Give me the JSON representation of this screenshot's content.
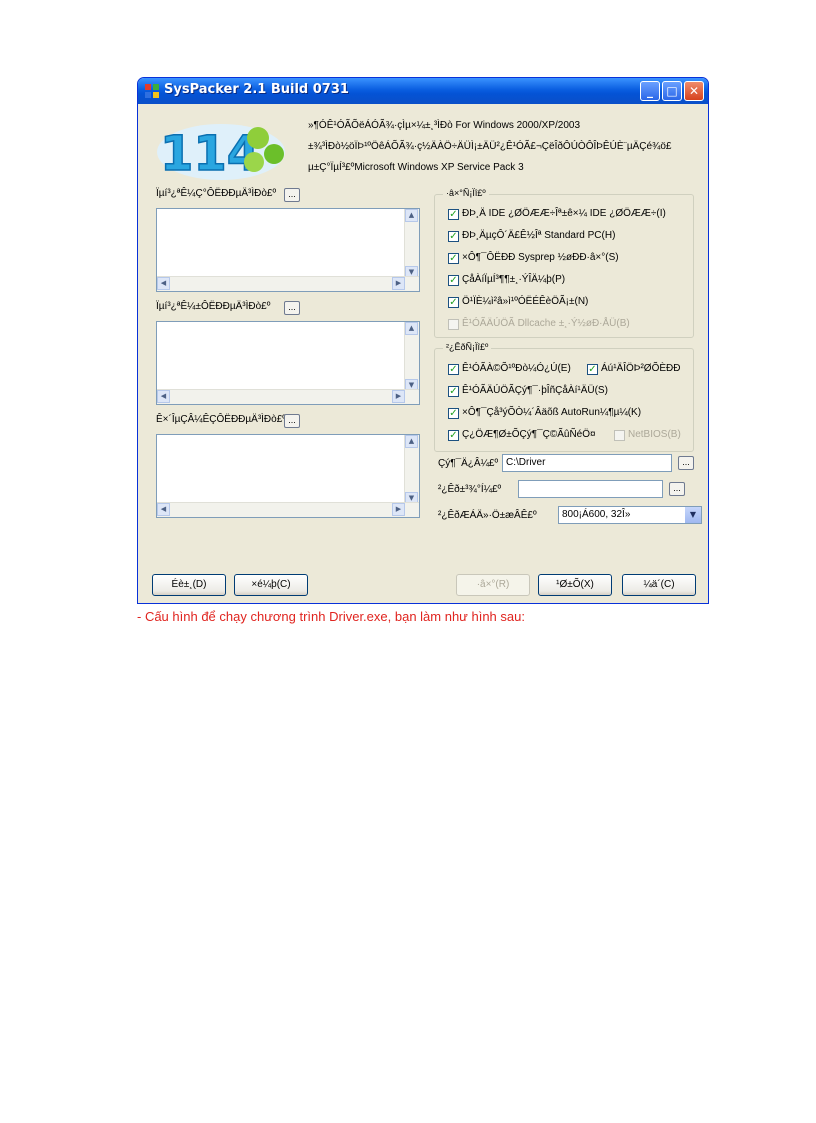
{
  "window": {
    "title": "SysPacker 2.1 Build 0731",
    "controls": {
      "minimize": "_",
      "maximize": "□",
      "close": "✕"
    }
  },
  "banner": {
    "logo_text": "114",
    "lines": [
      "»¶Ó­Ê¹ÓÃÕëÁÓÃ¾·çÌµ×¼±¸³ÌÐò For Windows 2000/XP/2003",
      "±¾³ÌÐò½öÏÞ¹ºÖêÁÕÃ¾·ç½ÄÀÖ÷ÄÜÌ¡±ÄÜ²¿Ê¹ÓÃ£¬ÇëÎðÔÚÒÔÎÞÊÚÈ¨µÄÇé¾ö£",
      "µ±Ç°ÏµÍ³£ºMicrosoft Windows XP Service Pack 3"
    ]
  },
  "left": {
    "groups": [
      {
        "label": "Ïµí³¿ªÊ¼Ç°ÔËÐÐµÄ³ÌÐò£º",
        "browse": "..."
      },
      {
        "label": "Ïµí³¿ªÊ¼±ÔËÐÐµÄ³ÌÐò£º",
        "browse": "..."
      },
      {
        "label": "Ê×´ÎµÇÂ¼ÊÇÔËÐÐµÄ³ÌÐò£º",
        "browse": "..."
      }
    ]
  },
  "options1": {
    "legend": "·â×°Ñ¡Ïî£º",
    "items": [
      {
        "label": "ÐÞ¸Ä IDE ¿ØÖÆÆ÷Îª±ê×¼ IDE ¿ØÖÆÆ÷(I)",
        "checked": true,
        "disabled": false
      },
      {
        "label": "ÐÞ¸ÄµçÔ´Ä£Ê½Îª Standard PC(H)",
        "checked": true,
        "disabled": false
      },
      {
        "label": "×Ô¶¯ÔËÐÐ Sysprep ½øÐÐ·â×°(S)",
        "checked": true,
        "disabled": false
      },
      {
        "label": "ÇåÀíÏµÍ³¶¶±¸·ÝÎÄ¼þ(P)",
        "checked": true,
        "disabled": false
      },
      {
        "label": "Ö¹ÏÈ¼ì²â»ì¹ºÓËÉÊèÖÃ¡±(N)",
        "checked": true,
        "disabled": false
      },
      {
        "label": "Ê¹ÓÃÄÚÖÃ Dllcache ±¸·Ý½øÐ·ÅÜ(B)",
        "checked": false,
        "disabled": true
      }
    ]
  },
  "options2": {
    "legend": "²¿ÊðÑ¡Ïî£º",
    "items": [
      {
        "label": "Ê¹ÓÃÀ©Õ¹ºÐò¼Ó¿Ú(E)",
        "checked": true,
        "disabled": false
      },
      {
        "label": "Áú¹ÄÎÖÞ²ØÕÈÐÐ",
        "checked": true,
        "disabled": false
      },
      {
        "label": "Ê¹ÓÃÄÚÖÃÇý¶¯·þÎñÇåÀí¹ÄÜ(S)",
        "checked": true,
        "disabled": false
      },
      {
        "label": "×Ô¶¯Çå³ýÕÒ¼´Âäõß AutoRun¼¶µ¼(K)",
        "checked": true,
        "disabled": false
      },
      {
        "label": "Ç¿ÖÆ¶Ø±ÕÇý¶¯Ç©ÃûÑéÖ¤",
        "checked": true,
        "disabled": false
      },
      {
        "label": "NetBIOS(B)",
        "checked": false,
        "disabled": true
      }
    ]
  },
  "fields": {
    "driver_dir_label": "Çý¶¯Ä¿Â¼£º",
    "driver_dir_value": "C:\\Driver",
    "bg_label": "²¿Êð±³¾°Í¼£º",
    "bg_value": "",
    "resolution_label": "²¿ÊðÆÁÄ»·Ö±æÂÊ£º",
    "resolution_value": "800¡Á600, 32Î»",
    "browse": "..."
  },
  "buttons": {
    "about": "Éè±¸(D)",
    "help": "×é¼þ(C)",
    "pack": "·â×°(R)",
    "close": "¹Ø±Õ(X)",
    "cancel": "¼ä´(C)"
  },
  "caption": "- Cấu hình để chạy chương trình Driver.exe, bạn làm như hình sau:",
  "colors": {
    "title_blue": "#0a5ee0",
    "caption_red": "#e0241f",
    "check_green": "#21a121"
  }
}
